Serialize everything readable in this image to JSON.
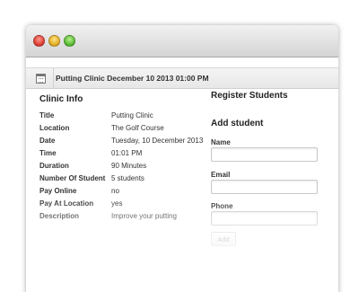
{
  "window": {
    "controls": [
      "close",
      "minimize",
      "zoom"
    ]
  },
  "header": {
    "icon": "calendar-icon",
    "title": "Putting Clinic December 10 2013 01:00 PM"
  },
  "clinic_info": {
    "heading": "Clinic Info",
    "rows": [
      {
        "label": "Title",
        "value": "Putting Clinic"
      },
      {
        "label": "Location",
        "value": "The Golf Course"
      },
      {
        "label": "Date",
        "value": "Tuesday, 10 December 2013"
      },
      {
        "label": "Time",
        "value": "01:01 PM"
      },
      {
        "label": "Duration",
        "value": "90 Minutes"
      },
      {
        "label": "Number Of Student",
        "value": "5 students"
      },
      {
        "label": "Pay Online",
        "value": "no"
      },
      {
        "label": "Pay At Location",
        "value": "yes"
      },
      {
        "label": "Description",
        "value": "Improve your putting"
      }
    ]
  },
  "register": {
    "heading": "Register Students",
    "subheading": "Add student",
    "fields": [
      {
        "label": "Name",
        "value": ""
      },
      {
        "label": "Email",
        "value": ""
      },
      {
        "label": "Phone",
        "value": ""
      }
    ],
    "add_label": "Add"
  },
  "colors": {
    "close": "#e0443a",
    "minimize": "#e6b22a",
    "zoom": "#5fbf3b"
  }
}
